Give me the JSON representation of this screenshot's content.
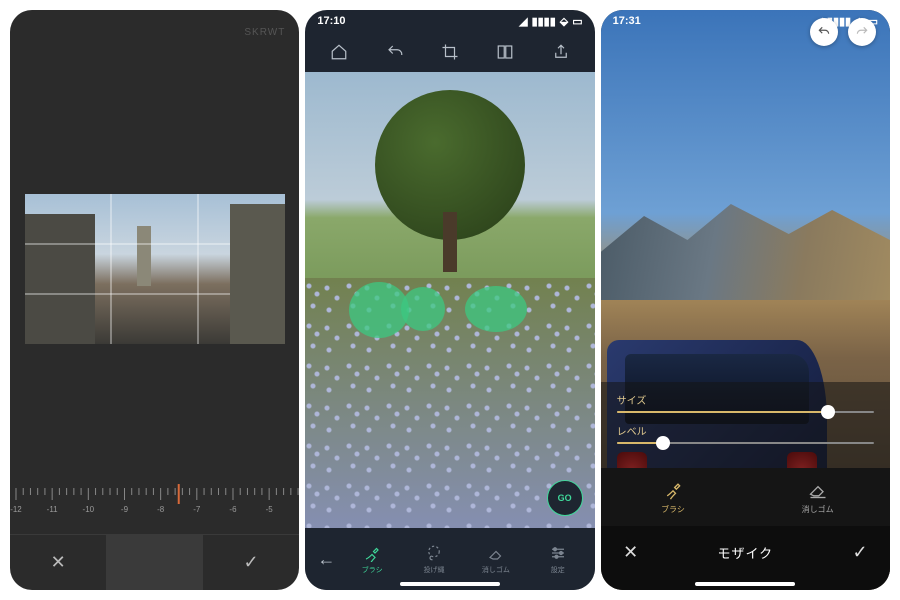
{
  "screen1": {
    "app_badge": "SKRWT",
    "ruler_values": [
      "-12",
      "-11",
      "-10",
      "-9",
      "-8",
      "-7",
      "-6",
      "-5"
    ],
    "ruler_center_value": "-8",
    "cancel_glyph": "✕",
    "confirm_glyph": "✓"
  },
  "screen2": {
    "status_time": "17:10",
    "toolbar_icons": [
      "home",
      "undo",
      "crop",
      "compare",
      "share"
    ],
    "go_label": "GO",
    "back_glyph": "←",
    "tools": [
      {
        "id": "brush",
        "label": "ブラシ",
        "active": true
      },
      {
        "id": "lasso",
        "label": "投げ縄",
        "active": false
      },
      {
        "id": "eraser",
        "label": "消しゴム",
        "active": false
      },
      {
        "id": "settings",
        "label": "設定",
        "active": false
      }
    ]
  },
  "screen3": {
    "status_time": "17:31",
    "sliders": [
      {
        "id": "size",
        "label": "サイズ",
        "value": 0.82
      },
      {
        "id": "level",
        "label": "レベル",
        "value": 0.18
      }
    ],
    "tools": [
      {
        "id": "brush",
        "label": "ブラシ",
        "active": true
      },
      {
        "id": "eraser",
        "label": "消しゴム",
        "active": false
      }
    ],
    "mode_title": "モザイク",
    "cancel_glyph": "✕",
    "confirm_glyph": "✓"
  }
}
